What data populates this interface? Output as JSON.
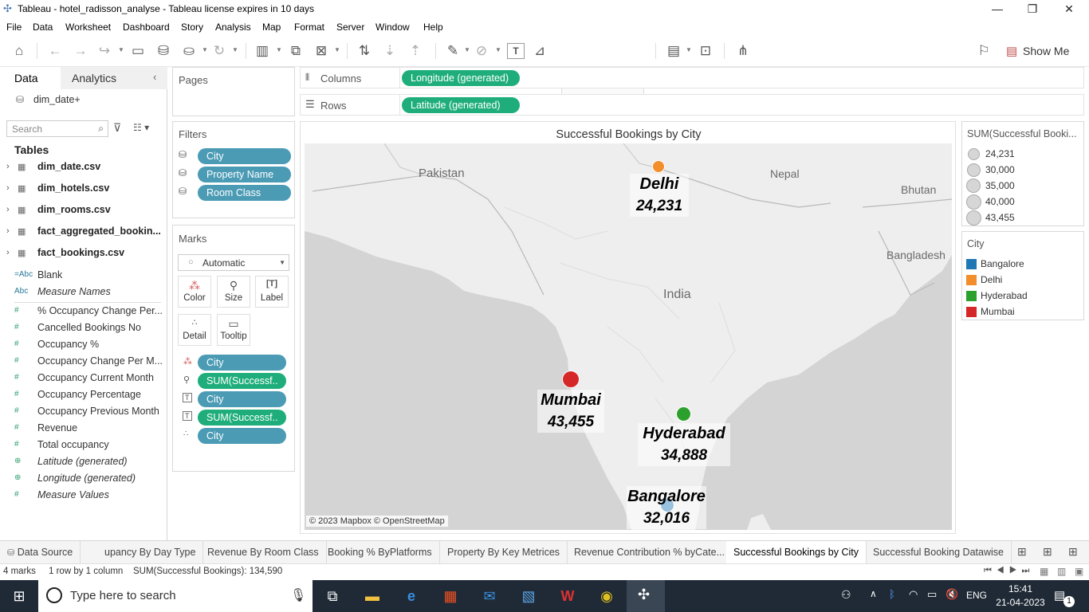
{
  "window": {
    "title": "Tableau - hotel_radisson_analyse - Tableau license expires in 10 days"
  },
  "menu": [
    "File",
    "Data",
    "Worksheet",
    "Dashboard",
    "Story",
    "Analysis",
    "Map",
    "Format",
    "Server",
    "Window",
    "Help"
  ],
  "toolbar": {
    "show_me": "Show Me"
  },
  "data_pane": {
    "tab_data": "Data",
    "tab_analytics": "Analytics",
    "datasource": "dim_date+",
    "search_placeholder": "Search",
    "tables_heading": "Tables",
    "tables": [
      "dim_date.csv",
      "dim_hotels.csv",
      "dim_rooms.csv",
      "fact_aggregated_bookin...",
      "fact_bookings.csv"
    ],
    "dimensions": [
      {
        "icon": "=Abc",
        "label": "Blank"
      },
      {
        "icon": "Abc",
        "label": "Measure Names"
      }
    ],
    "measures": [
      "% Occupancy Change Per...",
      "Cancelled Bookings No",
      "Occupancy %",
      "Occupancy Change Per M...",
      "Occupancy Current Month",
      "Occupancy Percentage",
      "Occupancy Previous Month",
      "Revenue",
      "Total occupancy",
      "Latitude (generated)",
      "Longitude (generated)",
      "Measure Values"
    ]
  },
  "pages": {
    "title": "Pages"
  },
  "filters": {
    "title": "Filters",
    "items": [
      "City",
      "Property Name",
      "Room Class"
    ]
  },
  "marks": {
    "title": "Marks",
    "type": "Automatic",
    "buttons": [
      "Color",
      "Size",
      "Label",
      "Detail",
      "Tooltip"
    ],
    "pills": [
      "City",
      "SUM(Successf..",
      "City",
      "SUM(Successf..",
      "City"
    ]
  },
  "shelves": {
    "columns_label": "Columns",
    "columns_pill": "Longitude (generated)",
    "rows_label": "Rows",
    "rows_pill": "Latitude (generated)"
  },
  "viz": {
    "title": "Successful Bookings by City",
    "map_labels": [
      "Pakistan",
      "Nepal",
      "Bhutan",
      "India",
      "Bangladesh"
    ],
    "attribution": "© 2023 Mapbox © OpenStreetMap",
    "cities": [
      {
        "name": "Delhi",
        "value": "24,231",
        "color": "#f28e2b"
      },
      {
        "name": "Mumbai",
        "value": "43,455",
        "color": "#d62728"
      },
      {
        "name": "Hyderabad",
        "value": "34,888",
        "color": "#2ca02c"
      },
      {
        "name": "Bangalore",
        "value": "32,016",
        "color": "#1f77b4"
      }
    ]
  },
  "size_legend": {
    "title": "SUM(Successful Booki...",
    "items": [
      "24,231",
      "30,000",
      "35,000",
      "40,000",
      "43,455"
    ]
  },
  "color_legend": {
    "title": "City",
    "items": [
      {
        "label": "Bangalore",
        "color": "#1f77b4"
      },
      {
        "label": "Delhi",
        "color": "#f28e2b"
      },
      {
        "label": "Hyderabad",
        "color": "#2ca02c"
      },
      {
        "label": "Mumbai",
        "color": "#d62728"
      }
    ]
  },
  "sheet_tabs": {
    "data_source": "Data Source",
    "tabs": [
      "upancy By Day Type",
      "Revenue By Room Class",
      "Booking % ByPlatforms",
      "Property By Key Metrices",
      "Revenue Contribution % byCate...",
      "Successful Bookings by City",
      "Successful Booking Datawise"
    ],
    "active": "Successful Bookings by City"
  },
  "status": {
    "marks": "4 marks",
    "grid": "1 row by 1 column",
    "sum": "SUM(Successful Bookings): 134,590"
  },
  "taskbar": {
    "search_placeholder": "Type here to search",
    "lang": "ENG",
    "time": "15:41",
    "date": "21-04-2023",
    "notif_count": "1"
  }
}
